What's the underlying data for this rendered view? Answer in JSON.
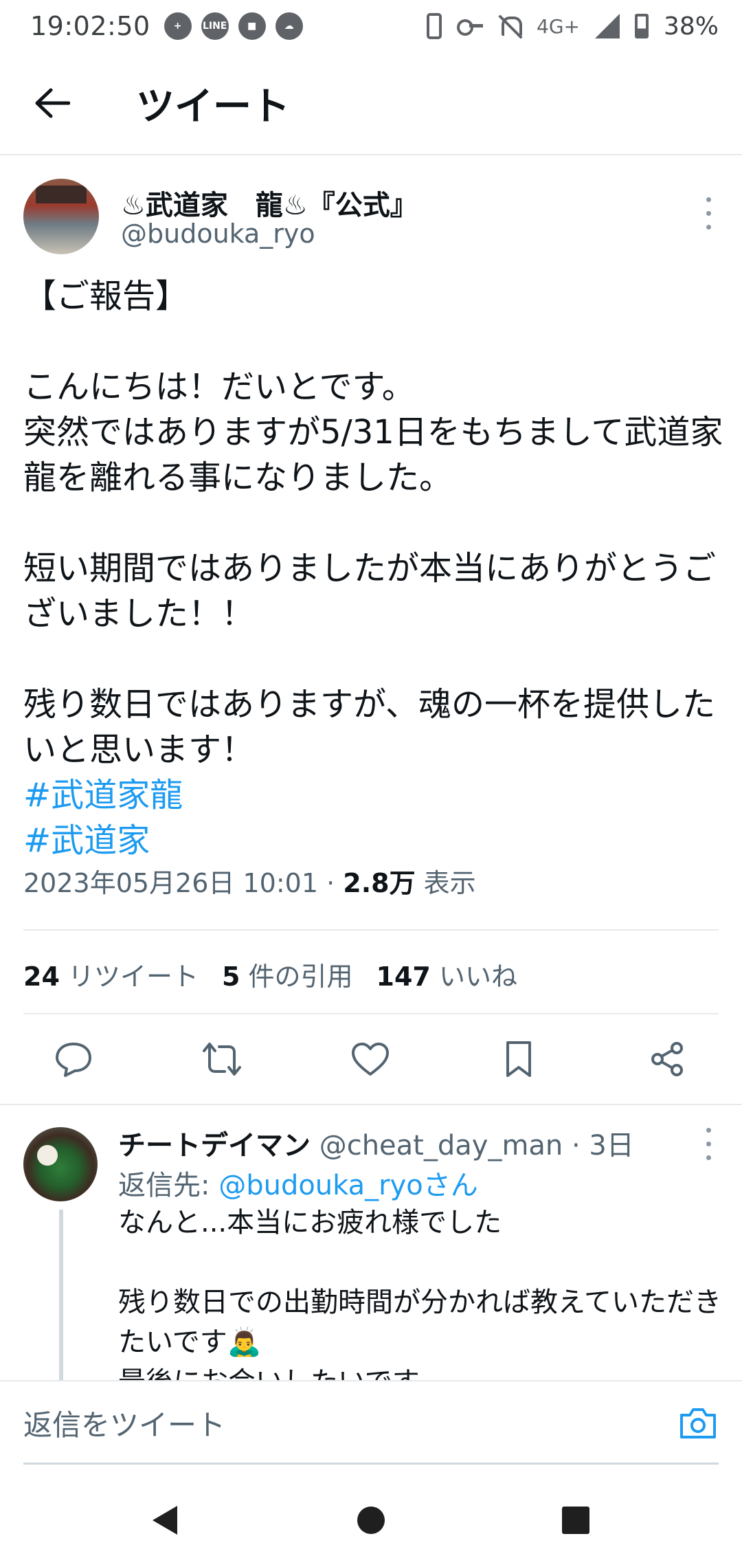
{
  "status_bar": {
    "time": "19:02:50",
    "network": "4G+",
    "battery": "38%",
    "left_icons": [
      "chat-plus-icon",
      "line-icon",
      "app-icon",
      "weather-icon"
    ],
    "right_icons": [
      "phone-icon",
      "key-icon",
      "bell-off-icon",
      "signal-icon",
      "battery-icon"
    ],
    "battery_level": 0.38
  },
  "header": {
    "title": "ツイート"
  },
  "tweet": {
    "author_name": "♨武道家　龍♨『公式』",
    "author_handle": "@budouka_ryo",
    "body": "【ご報告】\n\nこんにちは！だいとです。\n突然ではありますが5/31日をもちまして武道家龍を離れる事になりました。\n\n短い期間ではありましたが本当にありがとうございました！！\n\n残り数日ではありますが、魂の一杯を提供したいと思います！",
    "hashtags": [
      "#武道家龍",
      "#武道家"
    ],
    "timestamp": "2023年05月26日 10:01 · ",
    "views_count": "2.8万",
    "views_label": " 表示",
    "stats": {
      "retweets_count": "24",
      "retweets_label": " リツイート",
      "quotes_count": "5",
      "quotes_label": " 件の引用",
      "likes_count": "147",
      "likes_label": " いいね"
    }
  },
  "reply": {
    "name": "チートデイマン",
    "handle": " @cheat_day_man · 3日",
    "reply_to_label": "返信先: ",
    "reply_to_handle": "@budouka_ryoさん",
    "body": "なんと...本当にお疲れ様でした\n\n残り数日での出勤時間が分かれば教えていただきたいです🙇‍♂️\n最後にお会いしたいです"
  },
  "compose": {
    "placeholder": "返信をツイート"
  },
  "colors": {
    "accent": "#1d9bf0",
    "text": "#0f1419",
    "secondary": "#536471",
    "divider": "#e7e9ea"
  }
}
